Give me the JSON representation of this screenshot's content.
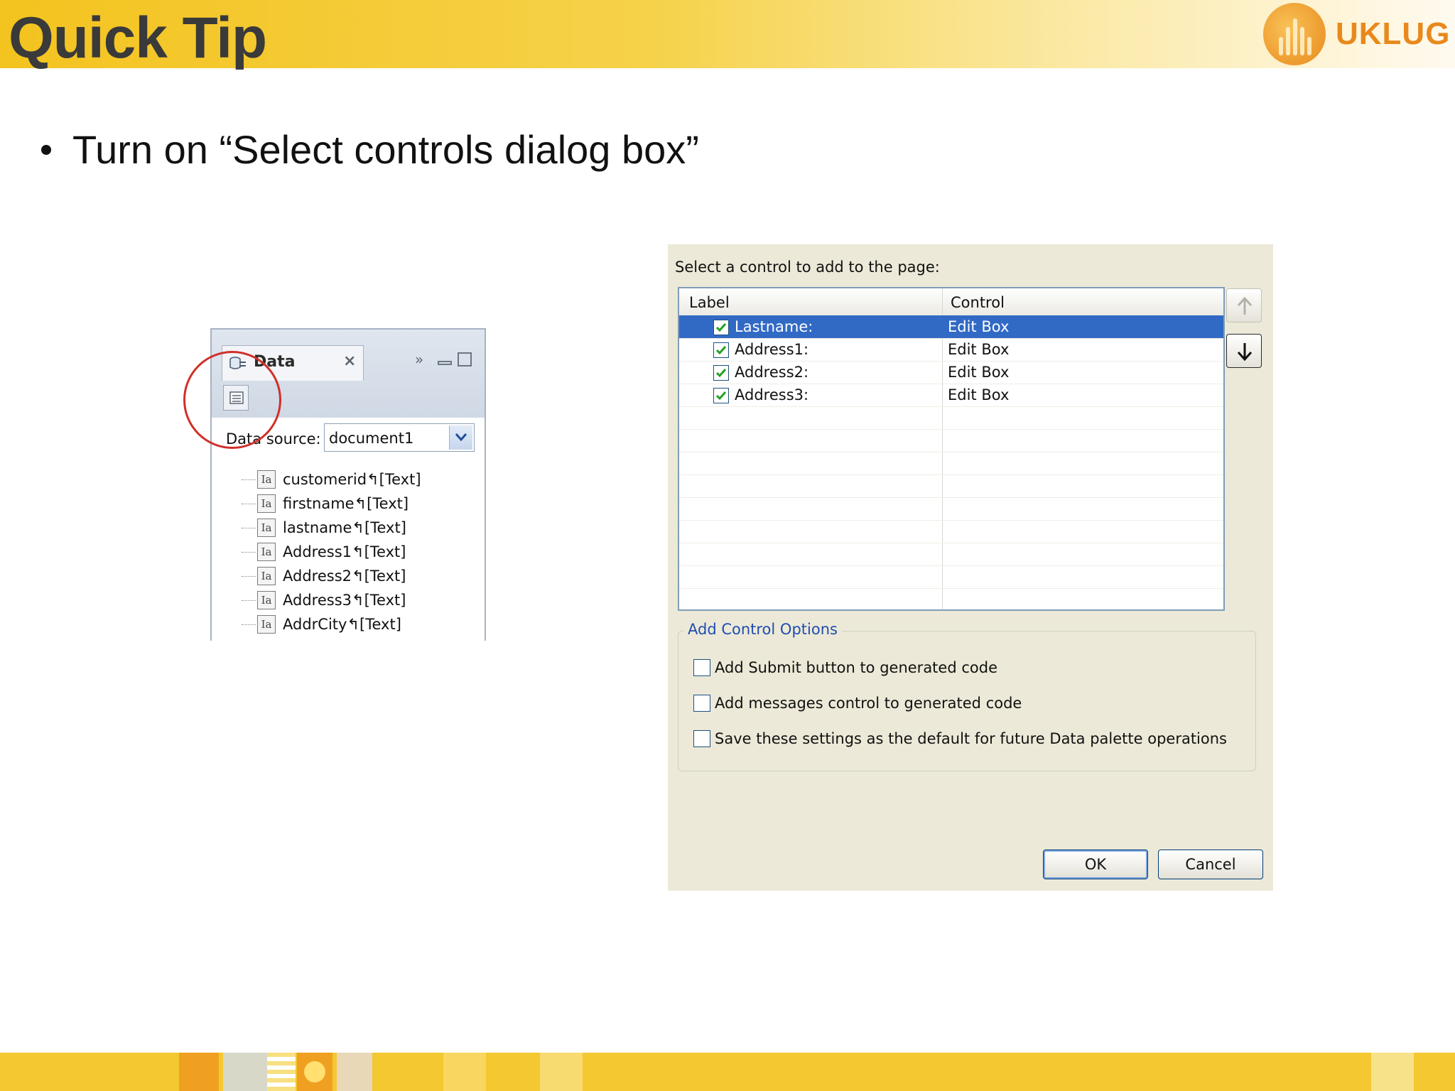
{
  "slide": {
    "title": "Quick Tip",
    "logo_text": "UKLUG",
    "bullet": "Turn on “Select controls dialog box”"
  },
  "palette": {
    "tab_label": "Data",
    "data_source_label": "Data source:",
    "data_source_value": "document1",
    "fields": [
      "customerid↰[Text]",
      "firstname↰[Text]",
      "lastname↰[Text]",
      "Address1↰[Text]",
      "Address2↰[Text]",
      "Address3↰[Text]",
      "AddrCity↰[Text]"
    ],
    "field_icon_glyph": "Ia"
  },
  "dialog": {
    "prompt": "Select a control to add to the page:",
    "columns": {
      "label": "Label",
      "control": "Control"
    },
    "rows": [
      {
        "label": "Lastname:",
        "control": "Edit Box",
        "checked": true,
        "selected": true
      },
      {
        "label": "Address1:",
        "control": "Edit Box",
        "checked": true,
        "selected": false
      },
      {
        "label": "Address2:",
        "control": "Edit Box",
        "checked": true,
        "selected": false
      },
      {
        "label": "Address3:",
        "control": "Edit Box",
        "checked": true,
        "selected": false
      }
    ],
    "options_title": "Add Control Options",
    "options": [
      {
        "label": "Add Submit button to generated code",
        "checked": false
      },
      {
        "label": "Add messages control to generated code",
        "checked": false
      },
      {
        "label": "Save these settings as the default for future Data palette operations",
        "checked": false
      }
    ],
    "ok_label": "OK",
    "cancel_label": "Cancel"
  },
  "colors": {
    "header_accent": "#f3c31f",
    "logo_orange": "#e8891c",
    "selection_blue": "#316ac5",
    "highlight_ring": "#d0302a",
    "dialog_bg": "#ece9d8",
    "group_title_blue": "#1f4eb0"
  },
  "icons": {
    "palette_tab": "data-palette-icon",
    "select_controls_toggle": "select-controls-dialog-icon",
    "data_source_dropdown": "chevron-down-icon",
    "move_up": "arrow-up-icon",
    "move_down": "arrow-down-icon",
    "checkbox_checked": "checkmark-icon"
  }
}
